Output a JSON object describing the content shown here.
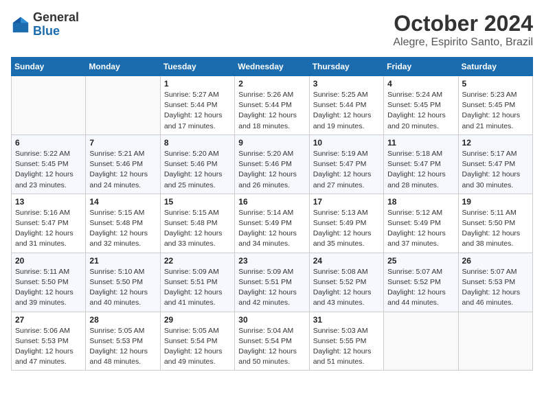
{
  "logo": {
    "line1": "General",
    "line2": "Blue"
  },
  "title": "October 2024",
  "location": "Alegre, Espirito Santo, Brazil",
  "weekdays": [
    "Sunday",
    "Monday",
    "Tuesday",
    "Wednesday",
    "Thursday",
    "Friday",
    "Saturday"
  ],
  "weeks": [
    [
      {
        "day": "",
        "info": ""
      },
      {
        "day": "",
        "info": ""
      },
      {
        "day": "1",
        "info": "Sunrise: 5:27 AM\nSunset: 5:44 PM\nDaylight: 12 hours and 17 minutes."
      },
      {
        "day": "2",
        "info": "Sunrise: 5:26 AM\nSunset: 5:44 PM\nDaylight: 12 hours and 18 minutes."
      },
      {
        "day": "3",
        "info": "Sunrise: 5:25 AM\nSunset: 5:44 PM\nDaylight: 12 hours and 19 minutes."
      },
      {
        "day": "4",
        "info": "Sunrise: 5:24 AM\nSunset: 5:45 PM\nDaylight: 12 hours and 20 minutes."
      },
      {
        "day": "5",
        "info": "Sunrise: 5:23 AM\nSunset: 5:45 PM\nDaylight: 12 hours and 21 minutes."
      }
    ],
    [
      {
        "day": "6",
        "info": "Sunrise: 5:22 AM\nSunset: 5:45 PM\nDaylight: 12 hours and 23 minutes."
      },
      {
        "day": "7",
        "info": "Sunrise: 5:21 AM\nSunset: 5:46 PM\nDaylight: 12 hours and 24 minutes."
      },
      {
        "day": "8",
        "info": "Sunrise: 5:20 AM\nSunset: 5:46 PM\nDaylight: 12 hours and 25 minutes."
      },
      {
        "day": "9",
        "info": "Sunrise: 5:20 AM\nSunset: 5:46 PM\nDaylight: 12 hours and 26 minutes."
      },
      {
        "day": "10",
        "info": "Sunrise: 5:19 AM\nSunset: 5:47 PM\nDaylight: 12 hours and 27 minutes."
      },
      {
        "day": "11",
        "info": "Sunrise: 5:18 AM\nSunset: 5:47 PM\nDaylight: 12 hours and 28 minutes."
      },
      {
        "day": "12",
        "info": "Sunrise: 5:17 AM\nSunset: 5:47 PM\nDaylight: 12 hours and 30 minutes."
      }
    ],
    [
      {
        "day": "13",
        "info": "Sunrise: 5:16 AM\nSunset: 5:47 PM\nDaylight: 12 hours and 31 minutes."
      },
      {
        "day": "14",
        "info": "Sunrise: 5:15 AM\nSunset: 5:48 PM\nDaylight: 12 hours and 32 minutes."
      },
      {
        "day": "15",
        "info": "Sunrise: 5:15 AM\nSunset: 5:48 PM\nDaylight: 12 hours and 33 minutes."
      },
      {
        "day": "16",
        "info": "Sunrise: 5:14 AM\nSunset: 5:49 PM\nDaylight: 12 hours and 34 minutes."
      },
      {
        "day": "17",
        "info": "Sunrise: 5:13 AM\nSunset: 5:49 PM\nDaylight: 12 hours and 35 minutes."
      },
      {
        "day": "18",
        "info": "Sunrise: 5:12 AM\nSunset: 5:49 PM\nDaylight: 12 hours and 37 minutes."
      },
      {
        "day": "19",
        "info": "Sunrise: 5:11 AM\nSunset: 5:50 PM\nDaylight: 12 hours and 38 minutes."
      }
    ],
    [
      {
        "day": "20",
        "info": "Sunrise: 5:11 AM\nSunset: 5:50 PM\nDaylight: 12 hours and 39 minutes."
      },
      {
        "day": "21",
        "info": "Sunrise: 5:10 AM\nSunset: 5:50 PM\nDaylight: 12 hours and 40 minutes."
      },
      {
        "day": "22",
        "info": "Sunrise: 5:09 AM\nSunset: 5:51 PM\nDaylight: 12 hours and 41 minutes."
      },
      {
        "day": "23",
        "info": "Sunrise: 5:09 AM\nSunset: 5:51 PM\nDaylight: 12 hours and 42 minutes."
      },
      {
        "day": "24",
        "info": "Sunrise: 5:08 AM\nSunset: 5:52 PM\nDaylight: 12 hours and 43 minutes."
      },
      {
        "day": "25",
        "info": "Sunrise: 5:07 AM\nSunset: 5:52 PM\nDaylight: 12 hours and 44 minutes."
      },
      {
        "day": "26",
        "info": "Sunrise: 5:07 AM\nSunset: 5:53 PM\nDaylight: 12 hours and 46 minutes."
      }
    ],
    [
      {
        "day": "27",
        "info": "Sunrise: 5:06 AM\nSunset: 5:53 PM\nDaylight: 12 hours and 47 minutes."
      },
      {
        "day": "28",
        "info": "Sunrise: 5:05 AM\nSunset: 5:53 PM\nDaylight: 12 hours and 48 minutes."
      },
      {
        "day": "29",
        "info": "Sunrise: 5:05 AM\nSunset: 5:54 PM\nDaylight: 12 hours and 49 minutes."
      },
      {
        "day": "30",
        "info": "Sunrise: 5:04 AM\nSunset: 5:54 PM\nDaylight: 12 hours and 50 minutes."
      },
      {
        "day": "31",
        "info": "Sunrise: 5:03 AM\nSunset: 5:55 PM\nDaylight: 12 hours and 51 minutes."
      },
      {
        "day": "",
        "info": ""
      },
      {
        "day": "",
        "info": ""
      }
    ]
  ]
}
